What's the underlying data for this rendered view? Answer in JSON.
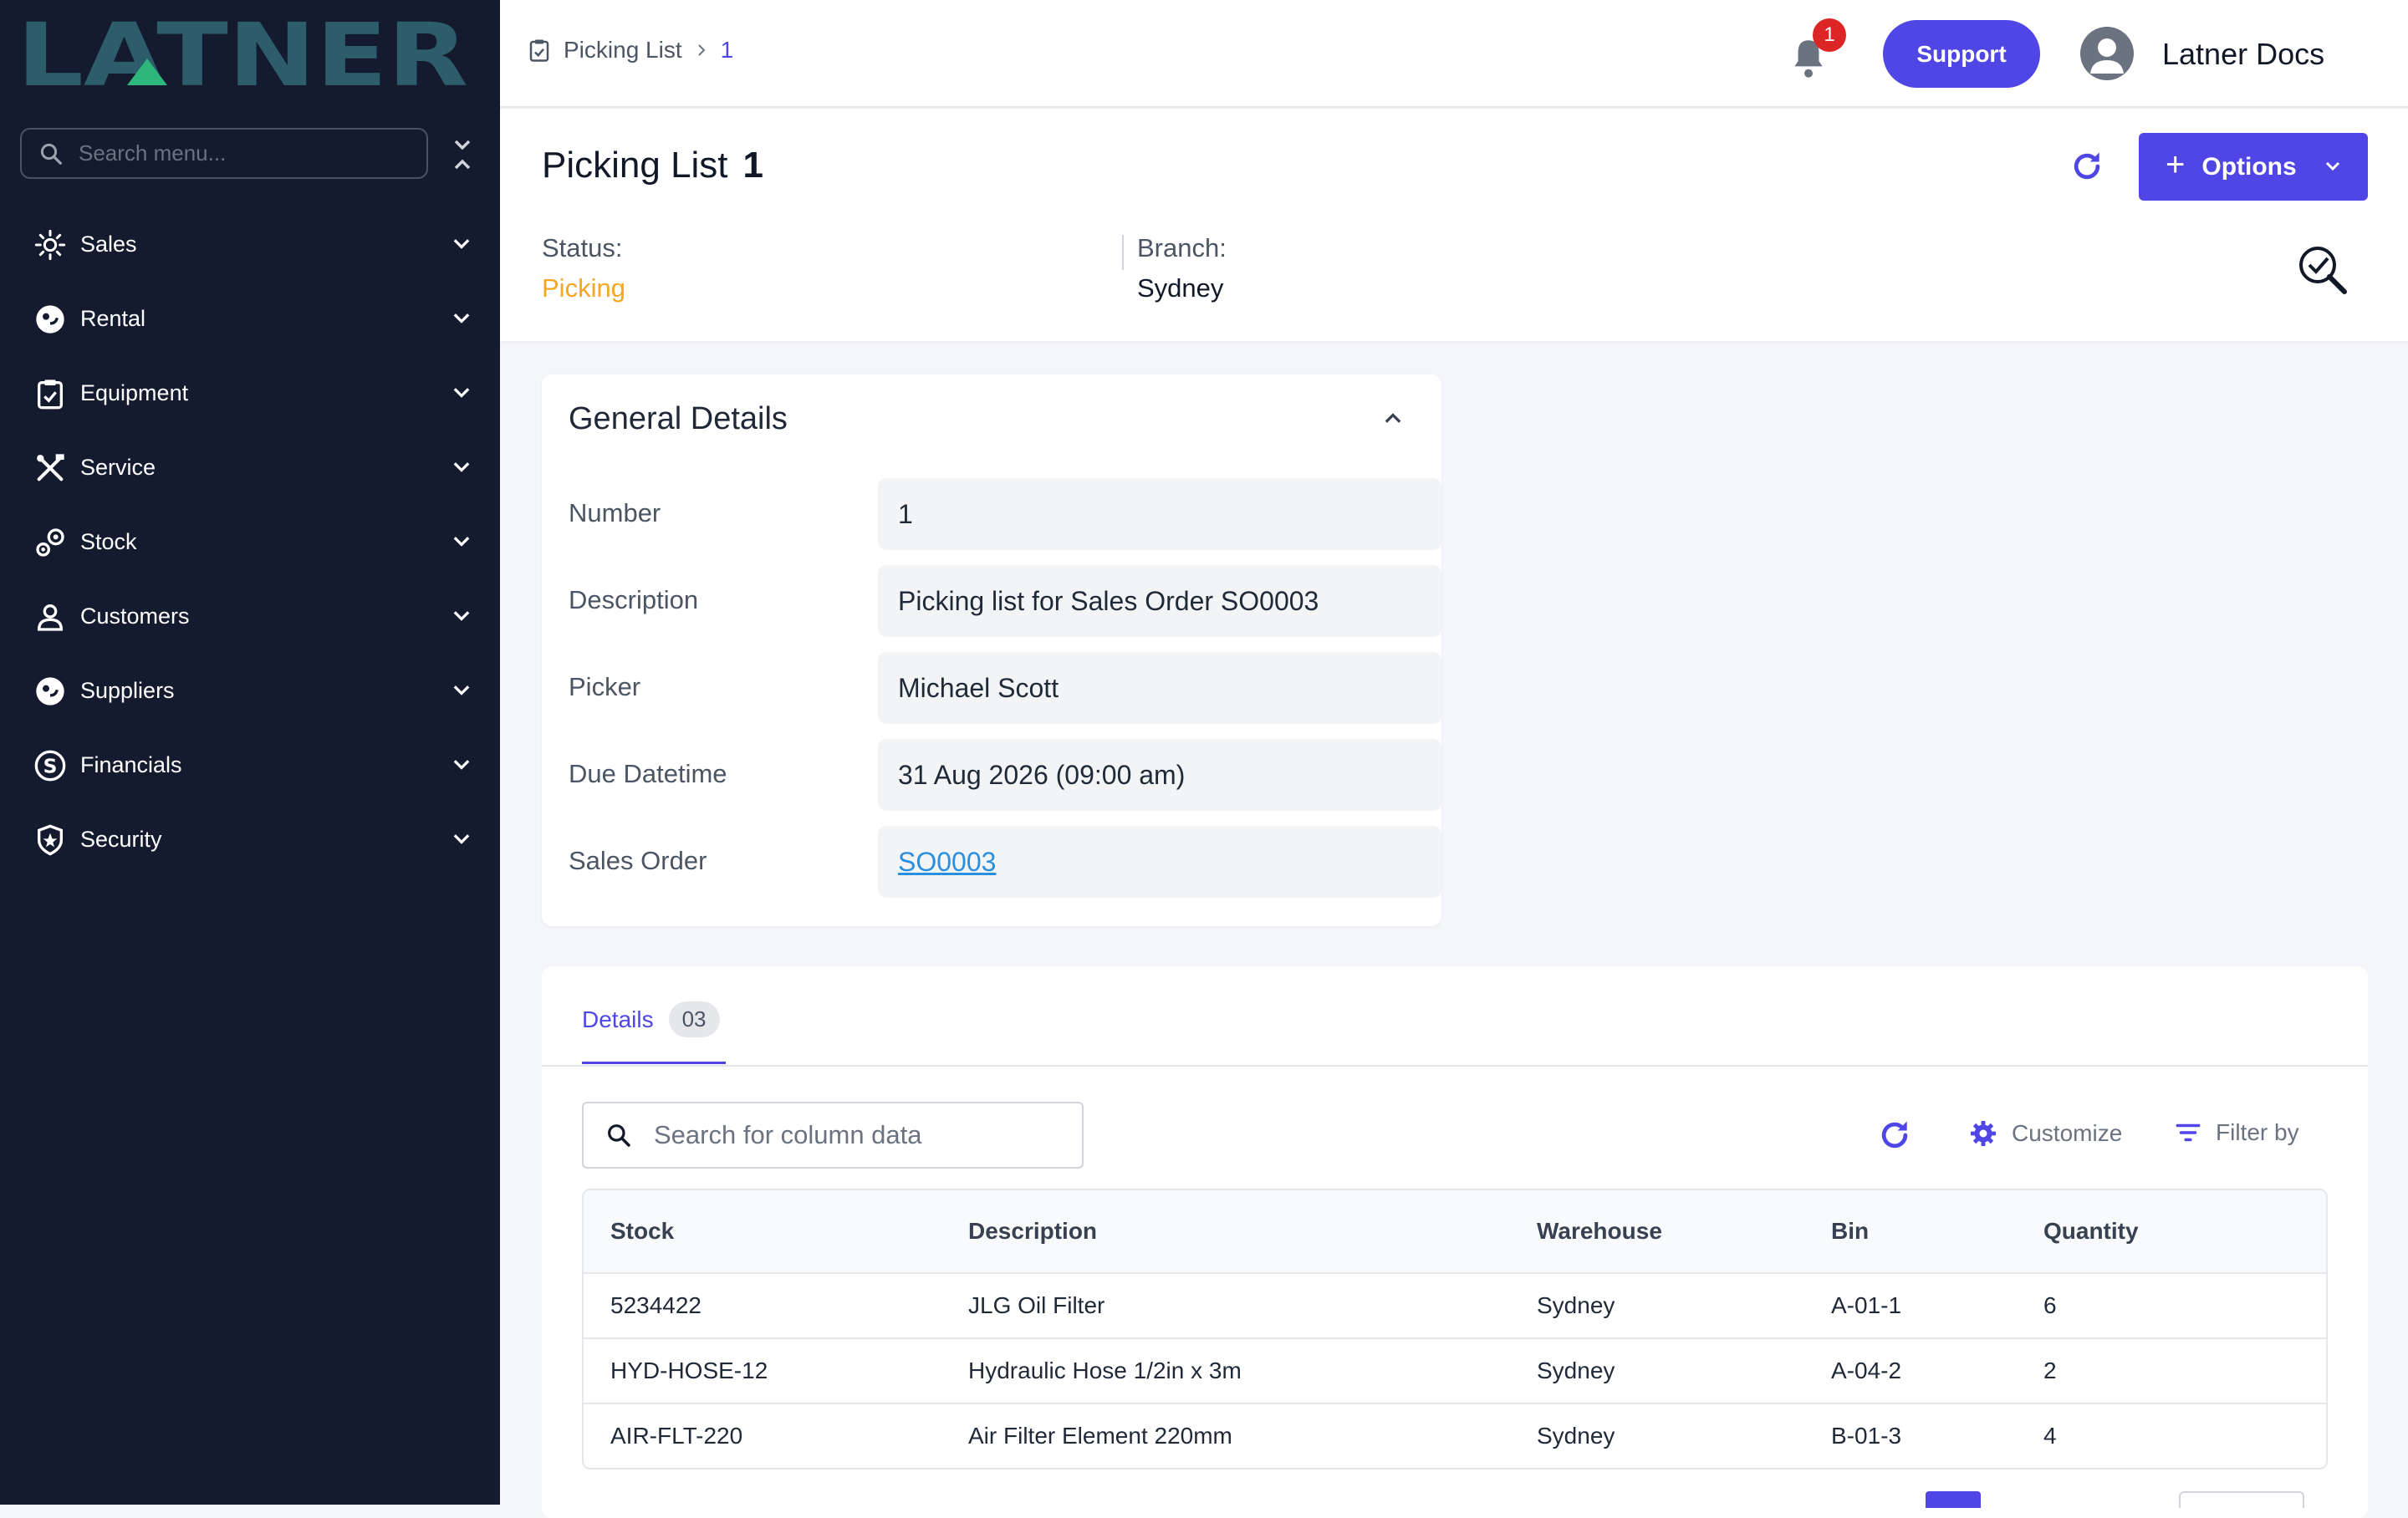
{
  "brand": {
    "logo_text": "LATNER",
    "logo_color": "#2d5d6b",
    "accent": "#2fb67a"
  },
  "sidebar": {
    "search_placeholder": "Search menu...",
    "items": [
      {
        "label": "Sales",
        "icon": "sales-icon"
      },
      {
        "label": "Rental",
        "icon": "rental-icon"
      },
      {
        "label": "Equipment",
        "icon": "equipment-icon"
      },
      {
        "label": "Service",
        "icon": "service-icon"
      },
      {
        "label": "Stock",
        "icon": "stock-icon"
      },
      {
        "label": "Customers",
        "icon": "customers-icon"
      },
      {
        "label": "Suppliers",
        "icon": "suppliers-icon"
      },
      {
        "label": "Financials",
        "icon": "financials-icon"
      },
      {
        "label": "Security",
        "icon": "security-icon"
      }
    ]
  },
  "topbar": {
    "breadcrumb": {
      "section": "Picking List",
      "current": "1"
    },
    "notification_count": "1",
    "support_label": "Support",
    "user_name": "Latner Docs"
  },
  "header": {
    "title": "Picking List",
    "number": "1",
    "options_label": "Options",
    "status_label": "Status:",
    "status_value": "Picking",
    "branch_label": "Branch:",
    "branch_value": "Sydney"
  },
  "general": {
    "title": "General Details",
    "fields": [
      {
        "label": "Number",
        "value": "1"
      },
      {
        "label": "Description",
        "value": "Picking list for Sales Order SO0003"
      },
      {
        "label": "Picker",
        "value": "Michael Scott"
      },
      {
        "label": "Due Datetime",
        "value": "31 Aug 2026 (09:00 am)"
      },
      {
        "label": "Sales Order",
        "value": "SO0003"
      }
    ]
  },
  "details": {
    "tab_label": "Details",
    "tab_count": "03",
    "search_placeholder": "Search for column data",
    "customize_label": "Customize",
    "filter_label": "Filter by",
    "columns": [
      "Stock",
      "Description",
      "Warehouse",
      "Bin",
      "Quantity"
    ],
    "rows": [
      [
        "5234422",
        "JLG Oil Filter",
        "Sydney",
        "A-01-1",
        "6"
      ],
      [
        "HYD-HOSE-12",
        "Hydraulic Hose 1/2in x 3m",
        "Sydney",
        "A-04-2",
        "2"
      ],
      [
        "AIR-FLT-220",
        "Air Filter Element 220mm",
        "Sydney",
        "B-01-3",
        "4"
      ]
    ]
  },
  "colors": {
    "primary": "#4f46e5",
    "status_picking": "#f5a623",
    "sidebar_bg": "#141b2e",
    "link": "#2b8fe0"
  }
}
